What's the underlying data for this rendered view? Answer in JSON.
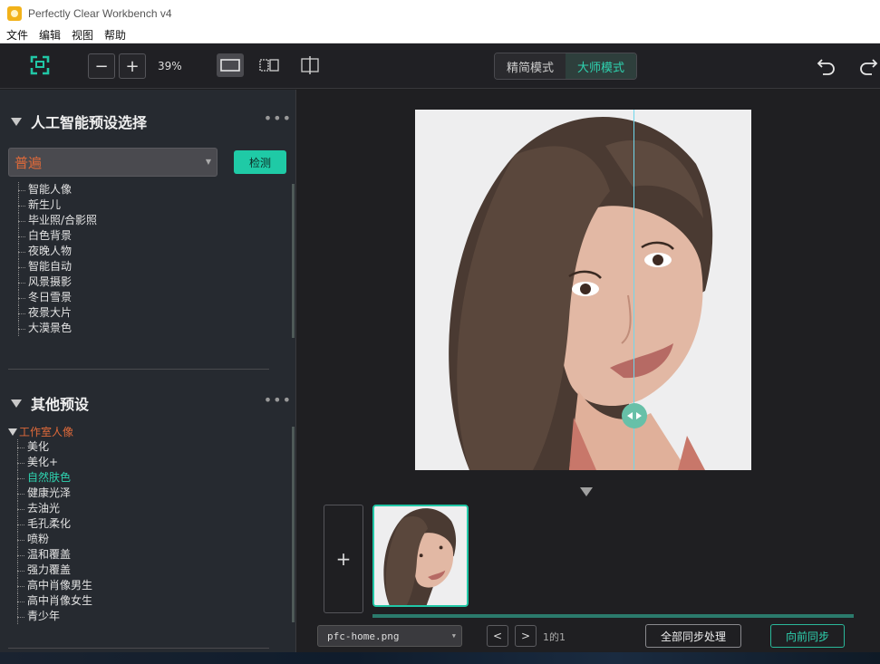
{
  "window": {
    "title": "Perfectly Clear Workbench v4"
  },
  "menu": {
    "items": [
      "文件",
      "编辑",
      "视图",
      "帮助"
    ]
  },
  "toolbar": {
    "zoom_out": "−",
    "zoom_in": "+",
    "zoom_value": "39%",
    "modes": [
      "精简模式",
      "大师模式"
    ],
    "active_mode": "大师模式"
  },
  "ai_presets": {
    "title": "人工智能预设选择",
    "more": "•••",
    "selected": "普遍",
    "detect_button": "检测",
    "items": [
      "智能人像",
      "新生儿",
      "毕业照/合影照",
      "白色背景",
      "夜晚人物",
      "智能自动",
      "风景摄影",
      "冬日雪景",
      "夜景大片",
      "大漠景色"
    ]
  },
  "other_presets": {
    "title": "其他预设",
    "more": "•••",
    "group": "工作室人像",
    "items": [
      "美化",
      "美化+",
      "自然肤色",
      "健康光泽",
      "去油光",
      "毛孔柔化",
      "喷粉",
      "温和覆盖",
      "强力覆盖",
      "高中肖像男生",
      "高中肖像女生",
      "青少年"
    ],
    "active_item": "自然肤色"
  },
  "filmstrip": {
    "add_label": "+",
    "file_name": "pfc-home.png",
    "page_indicator": "1的1",
    "prev": "<",
    "next": ">",
    "sync_all": "全部同步处理",
    "sync_forward": "向前同步"
  },
  "colors": {
    "accent": "#21c7a6",
    "preset_text": "#e06a3a"
  }
}
